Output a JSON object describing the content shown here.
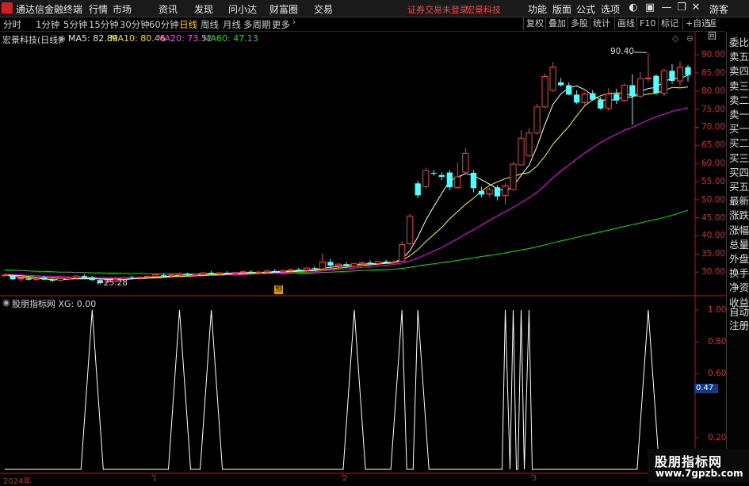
{
  "menubar": {
    "app_title": "通达信金融终端",
    "menus": [
      "行情",
      "市场",
      "资讯",
      "发现",
      "问小达",
      "财富圈",
      "交易"
    ],
    "notice": "证券交易未登录",
    "stock_tag": "宏景科技",
    "right_menus": [
      "功能",
      "版面",
      "公式",
      "选项"
    ],
    "user": "游客"
  },
  "periods": {
    "tabs": [
      "分时",
      "1分钟",
      "5分钟",
      "15分钟",
      "30分钟",
      "60分钟",
      "日线",
      "周线",
      "月线",
      "多周期",
      "更多"
    ],
    "active": "日线",
    "tools": [
      "复权",
      "叠加",
      "多股",
      "统计",
      "画线",
      "F10",
      "标记",
      "+自选",
      "返回"
    ]
  },
  "main_chart": {
    "title": "宏景科技(日线)",
    "ma5": "MA5: 82.89",
    "ma10": "MA10: 80.46",
    "ma20": "MA20: 73.52",
    "ma60": "MA60: 47.13",
    "high_label": "90.40",
    "low_label": "25.28",
    "event_badge": "预",
    "y_ticks": [
      "90.00",
      "85.00",
      "80.00",
      "75.00",
      "70.00",
      "65.00",
      "60.00",
      "55.00",
      "50.00",
      "45.00",
      "40.00",
      "35.00",
      "30.00"
    ]
  },
  "indicator": {
    "title": "股朋指标网 XG: 0.00",
    "y_ticks": [
      "1.00",
      "0.80",
      "0.60",
      "0.20"
    ],
    "current_value": "0.47"
  },
  "x_axis": {
    "labels": [
      "2024年",
      "1",
      "2",
      "3"
    ]
  },
  "side_panel": {
    "items": [
      "委比",
      "卖五",
      "卖四",
      "卖三",
      "卖二",
      "卖一",
      "买一",
      "买二",
      "买三",
      "买四",
      "买五",
      "最新",
      "涨跌",
      "涨幅",
      "总量",
      "外盘",
      "换手",
      "净资",
      "收益"
    ],
    "bottom_items": [
      "自动",
      "注册"
    ]
  },
  "watermark": {
    "line1": "股朋指标网",
    "line2": "www.7gpzb.com"
  },
  "colors": {
    "up": "#ff3c3c",
    "down": "#54ffff",
    "ma5": "#ffffff",
    "ma10": "#ffff00",
    "ma20": "#ff00ff",
    "ma60": "#00e600",
    "axis": "#b01818"
  },
  "chart_data": [
    {
      "type": "candlestick",
      "title": "宏景科技(日线)",
      "ylim": [
        25,
        92
      ],
      "high_marker": 90.4,
      "low_marker": 25.28,
      "ohlc": [
        [
          29,
          29.6,
          28.6,
          29.2
        ],
        [
          29.1,
          29.3,
          27.8,
          28.0
        ],
        [
          28.1,
          28.5,
          27.4,
          28.3
        ],
        [
          28.2,
          28.7,
          27.7,
          27.9
        ],
        [
          28.0,
          28.6,
          27.6,
          28.2
        ],
        [
          28.4,
          29.0,
          27.8,
          27.9
        ],
        [
          27.9,
          28.3,
          27.2,
          27.6
        ],
        [
          27.7,
          28.4,
          27.3,
          28.2
        ],
        [
          28.1,
          28.6,
          27.7,
          28.4
        ],
        [
          28.4,
          29.2,
          28.1,
          28.9
        ],
        [
          28.9,
          29.4,
          28.2,
          28.5
        ],
        [
          28.5,
          28.9,
          27.6,
          27.8
        ],
        [
          27.8,
          28.3,
          26.6,
          27.2
        ],
        [
          27.3,
          27.9,
          26.9,
          27.6
        ],
        [
          27.5,
          28.3,
          27.2,
          28.0
        ],
        [
          28.1,
          28.7,
          27.6,
          28.5
        ],
        [
          28.6,
          29.0,
          28.2,
          28.4
        ],
        [
          28.4,
          28.8,
          27.9,
          28.6
        ],
        [
          28.6,
          29.0,
          28.3,
          28.8
        ],
        [
          28.8,
          29.6,
          28.5,
          29.3
        ],
        [
          29.2,
          29.7,
          28.8,
          29.0
        ],
        [
          29.0,
          29.4,
          28.6,
          29.2
        ],
        [
          29.2,
          29.9,
          28.9,
          29.5
        ],
        [
          29.5,
          29.8,
          28.9,
          29.1
        ],
        [
          29.1,
          29.6,
          28.8,
          29.4
        ],
        [
          29.4,
          30.1,
          29.1,
          29.8
        ],
        [
          29.8,
          30.3,
          29.2,
          29.5
        ],
        [
          29.5,
          30.0,
          29.1,
          29.8
        ],
        [
          29.8,
          30.2,
          29.4,
          29.6
        ],
        [
          29.6,
          30.1,
          29.3,
          29.9
        ],
        [
          29.9,
          30.4,
          29.5,
          30.1
        ],
        [
          30.1,
          30.5,
          29.6,
          29.8
        ],
        [
          29.8,
          30.3,
          29.5,
          30.0
        ],
        [
          30.0,
          30.6,
          29.7,
          30.3
        ],
        [
          30.3,
          30.8,
          29.9,
          30.1
        ],
        [
          30.1,
          30.7,
          29.8,
          30.4
        ],
        [
          30.4,
          31.0,
          30.1,
          30.7
        ],
        [
          30.7,
          31.2,
          30.3,
          30.5
        ],
        [
          30.5,
          31.4,
          30.2,
          31.1
        ],
        [
          31.1,
          31.6,
          30.6,
          30.9
        ],
        [
          30.9,
          35.2,
          30.6,
          32.8
        ],
        [
          32.8,
          33.6,
          31.4,
          31.8
        ],
        [
          31.8,
          32.5,
          31.2,
          32.2
        ],
        [
          32.2,
          32.8,
          31.4,
          31.6
        ],
        [
          31.6,
          32.6,
          31.2,
          32.3
        ],
        [
          32.3,
          33.0,
          31.8,
          32.6
        ],
        [
          32.6,
          33.2,
          32.0,
          32.4
        ],
        [
          32.4,
          33.0,
          31.9,
          32.9
        ],
        [
          32.9,
          33.4,
          32.2,
          32.6
        ],
        [
          32.6,
          33.2,
          32.2,
          32.8
        ],
        [
          33.0,
          38.5,
          32.8,
          37.6
        ],
        [
          37.8,
          46.0,
          37.5,
          45.4
        ],
        [
          54.5,
          55.2,
          50.5,
          51.2
        ],
        [
          53.6,
          58.8,
          53.0,
          58.0
        ],
        [
          57.4,
          58.2,
          56.6,
          57.2
        ],
        [
          56.8,
          57.6,
          55.4,
          56.3
        ],
        [
          57.5,
          58.2,
          52.6,
          53.4
        ],
        [
          53.4,
          60.2,
          53.0,
          56.3
        ],
        [
          57.6,
          64.2,
          57.2,
          62.8
        ],
        [
          57.4,
          58.2,
          52.0,
          53.2
        ],
        [
          52.4,
          53.6,
          50.6,
          51.4
        ],
        [
          51.6,
          53.4,
          50.8,
          52.8
        ],
        [
          53.4,
          54.0,
          49.8,
          50.9
        ],
        [
          51.2,
          54.6,
          48.6,
          53.8
        ],
        [
          52.8,
          60.5,
          52.5,
          59.8
        ],
        [
          59.6,
          69.2,
          59.4,
          67.0
        ],
        [
          62.2,
          69.8,
          61.8,
          68.4
        ],
        [
          68.4,
          76.5,
          68.0,
          75.6
        ],
        [
          75.6,
          84.8,
          75.2,
          84.0
        ],
        [
          80.2,
          88.0,
          79.8,
          86.6
        ],
        [
          82.4,
          83.6,
          81.2,
          81.6
        ],
        [
          81.6,
          82.4,
          78.8,
          79.0
        ],
        [
          79.0,
          80.2,
          76.4,
          76.8
        ],
        [
          76.8,
          79.6,
          76.2,
          79.2
        ],
        [
          79.4,
          80.2,
          77.2,
          77.6
        ],
        [
          77.6,
          78.4,
          74.8,
          75.2
        ],
        [
          75.2,
          80.8,
          74.6,
          79.2
        ],
        [
          79.2,
          80.6,
          76.4,
          77.4
        ],
        [
          77.4,
          82.2,
          77.0,
          81.6
        ],
        [
          81.6,
          84.6,
          70.6,
          78.6
        ],
        [
          78.6,
          85.2,
          78.0,
          83.4
        ],
        [
          83.4,
          90.4,
          82.4,
          83.6
        ],
        [
          84.2,
          84.6,
          79.0,
          79.4
        ],
        [
          79.4,
          86.2,
          78.6,
          85.6
        ],
        [
          85.6,
          87.4,
          82.0,
          82.8
        ],
        [
          82.8,
          88.2,
          81.4,
          86.6
        ],
        [
          86.6,
          87.2,
          82.6,
          84.4
        ]
      ],
      "ma5": [
        29.1,
        28.9,
        28.6,
        28.4,
        28.2,
        28.1,
        27.9,
        27.9,
        28.0,
        28.2,
        28.3,
        28.3,
        28.1,
        28.0,
        27.8,
        27.9,
        28.1,
        28.3,
        28.5,
        28.6,
        28.8,
        28.9,
        29.1,
        29.2,
        29.3,
        29.4,
        29.5,
        29.5,
        29.6,
        29.7,
        29.8,
        29.9,
        29.9,
        30.0,
        30.1,
        30.2,
        30.3,
        30.4,
        30.5,
        30.6,
        31.1,
        31.3,
        31.6,
        31.8,
        32.1,
        32.2,
        32.3,
        32.4,
        32.6,
        32.7,
        33.6,
        35.9,
        39.7,
        44.3,
        48.1,
        51.7,
        55.2,
        56.2,
        57.2,
        56.6,
        55.5,
        54.3,
        53.0,
        52.4,
        53.7,
        56.7,
        59.5,
        64.7,
        70.8,
        76.3,
        79.2,
        80.9,
        81.4,
        80.4,
        78.8,
        77.6,
        77.4,
        77.7,
        78.4,
        78.3,
        79.8,
        80.7,
        81.0,
        82.6,
        83.5,
        83.4,
        84.4
      ],
      "ma10": [
        29.2,
        29.1,
        29.0,
        28.8,
        28.6,
        28.5,
        28.4,
        28.3,
        28.2,
        28.1,
        28.1,
        28.1,
        28.1,
        28.1,
        28.1,
        28.1,
        28.1,
        28.2,
        28.3,
        28.4,
        28.5,
        28.7,
        28.8,
        28.9,
        29.0,
        29.1,
        29.2,
        29.3,
        29.4,
        29.5,
        29.6,
        29.7,
        29.8,
        29.8,
        29.9,
        30.0,
        30.1,
        30.2,
        30.3,
        30.4,
        30.7,
        30.9,
        31.1,
        31.3,
        31.6,
        31.8,
        32.0,
        32.2,
        32.4,
        32.5,
        33.2,
        34.5,
        36.2,
        38.4,
        40.4,
        42.3,
        44.7,
        46.7,
        48.7,
        50.4,
        52.3,
        53.9,
        54.9,
        55.8,
        56.4,
        57.1,
        57.5,
        59.3,
        62.0,
        65.3,
        67.8,
        70.2,
        73.2,
        75.9,
        77.6,
        78.7,
        79.3,
        79.5,
        79.4,
        78.6,
        78.7,
        79.2,
        79.4,
        80.1,
        81.0,
        80.9,
        81.1
      ],
      "ma20": [
        29.4,
        29.3,
        29.2,
        29.1,
        29.0,
        28.9,
        28.9,
        28.8,
        28.7,
        28.7,
        28.6,
        28.6,
        28.5,
        28.5,
        28.5,
        28.5,
        28.5,
        28.5,
        28.5,
        28.6,
        28.6,
        28.7,
        28.8,
        28.8,
        28.9,
        29.0,
        29.1,
        29.1,
        29.2,
        29.3,
        29.3,
        29.4,
        29.5,
        29.6,
        29.6,
        29.7,
        29.8,
        29.9,
        30.0,
        30.1,
        30.3,
        30.5,
        30.7,
        30.9,
        31.1,
        31.3,
        31.5,
        31.7,
        31.9,
        32.1,
        32.5,
        33.1,
        33.9,
        34.8,
        35.8,
        36.8,
        38.0,
        39.2,
        40.5,
        41.7,
        43.0,
        44.3,
        45.5,
        46.7,
        47.9,
        49.2,
        50.5,
        52.1,
        54.0,
        56.1,
        57.9,
        59.6,
        61.3,
        62.9,
        64.4,
        65.8,
        67.0,
        68.1,
        69.2,
        70.0,
        71.0,
        72.0,
        72.9,
        73.6,
        74.4,
        74.9,
        75.4
      ],
      "ma60": [
        30.6,
        30.5,
        30.4,
        30.3,
        30.2,
        30.2,
        30.1,
        30.0,
        30.0,
        29.9,
        29.9,
        29.8,
        29.8,
        29.7,
        29.7,
        29.6,
        29.6,
        29.6,
        29.5,
        29.5,
        29.5,
        29.5,
        29.5,
        29.5,
        29.5,
        29.5,
        29.5,
        29.5,
        29.5,
        29.5,
        29.5,
        29.5,
        29.6,
        29.6,
        29.6,
        29.6,
        29.7,
        29.7,
        29.7,
        29.8,
        29.9,
        30.0,
        30.1,
        30.2,
        30.3,
        30.4,
        30.5,
        30.6,
        30.7,
        30.8,
        31.0,
        31.3,
        31.7,
        32.0,
        32.3,
        32.6,
        32.9,
        33.2,
        33.6,
        33.9,
        34.3,
        34.6,
        34.9,
        35.3,
        35.7,
        36.1,
        36.5,
        37.0,
        37.5,
        38.1,
        38.6,
        39.1,
        39.6,
        40.1,
        40.6,
        41.1,
        41.6,
        42.1,
        42.6,
        43.1,
        43.6,
        44.1,
        44.6,
        45.1,
        45.7,
        46.4,
        47.1
      ]
    },
    {
      "type": "line",
      "title": "股朋指标网 XG",
      "ylim": [
        0,
        1.05
      ],
      "signal_days": [
        11,
        22,
        26,
        44,
        50,
        52,
        63,
        64,
        65,
        66,
        81
      ],
      "values_note_free": true
    }
  ]
}
